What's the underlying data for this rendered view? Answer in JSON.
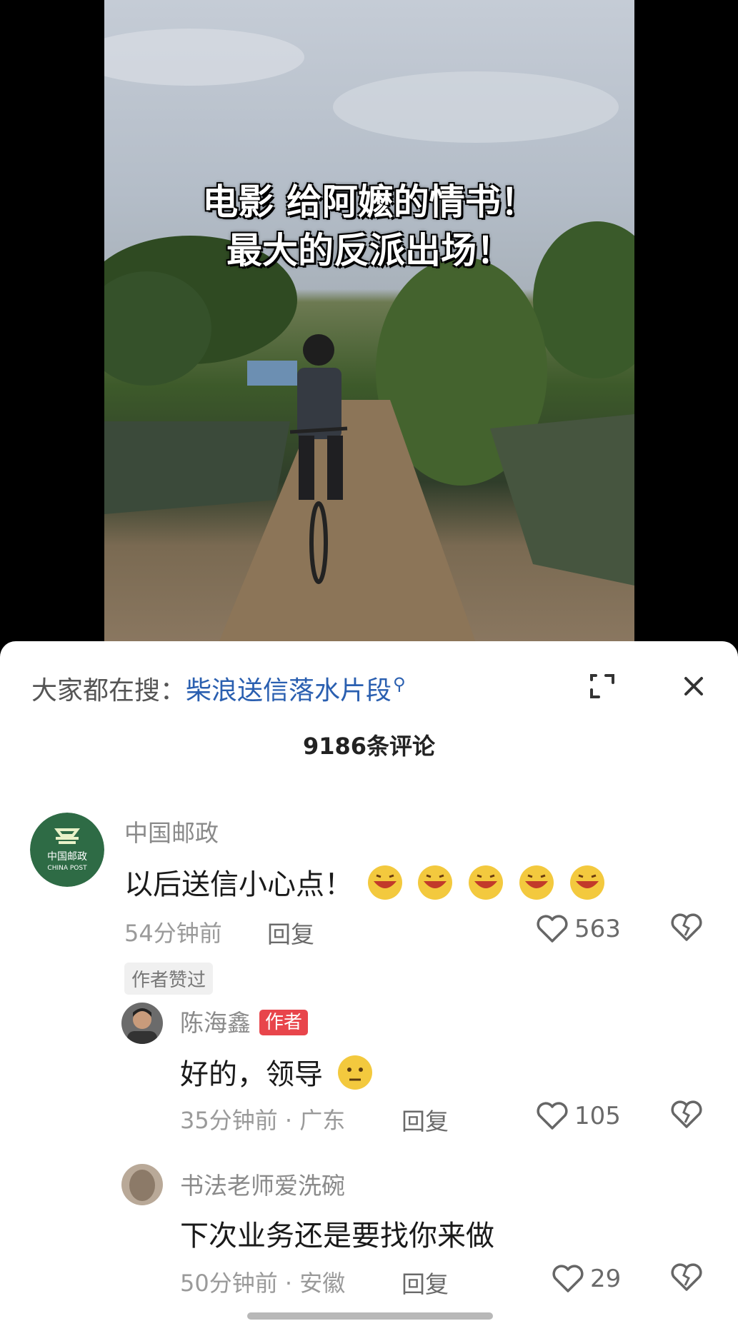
{
  "video": {
    "caption_line1": "电影 给阿嬷的情书！",
    "caption_line2": "最大的反派出场！"
  },
  "search": {
    "label": "大家都在搜：",
    "keyword": "柴浪送信落水片段",
    "icon": "search-icon"
  },
  "sheet": {
    "comment_count": "9186条评论",
    "expand_icon": "expand-icon",
    "close_icon": "close-icon"
  },
  "comments": [
    {
      "username": "中国邮政",
      "avatar_text": "中国邮政",
      "avatar_subtext": "CHINA POST",
      "text": "以后送信小心点！",
      "emoji_count": 5,
      "time": "54分钟前",
      "reply": "回复",
      "likes": "563",
      "author_liked": "作者赞过"
    },
    {
      "username": "陈海鑫",
      "badge": "作者",
      "text": "好的，领导",
      "emoji_count": 1,
      "time": "35分钟前 · 广东",
      "reply": "回复",
      "likes": "105"
    },
    {
      "username": "书法老师爱洗碗",
      "text": "下次业务还是要找你来做",
      "time": "50分钟前 · 安徽",
      "reply": "回复",
      "likes": "29"
    }
  ],
  "colors": {
    "accent_link": "#2a5fb0",
    "author_badge": "#e8454b",
    "china_post_green": "#2e6b45"
  }
}
